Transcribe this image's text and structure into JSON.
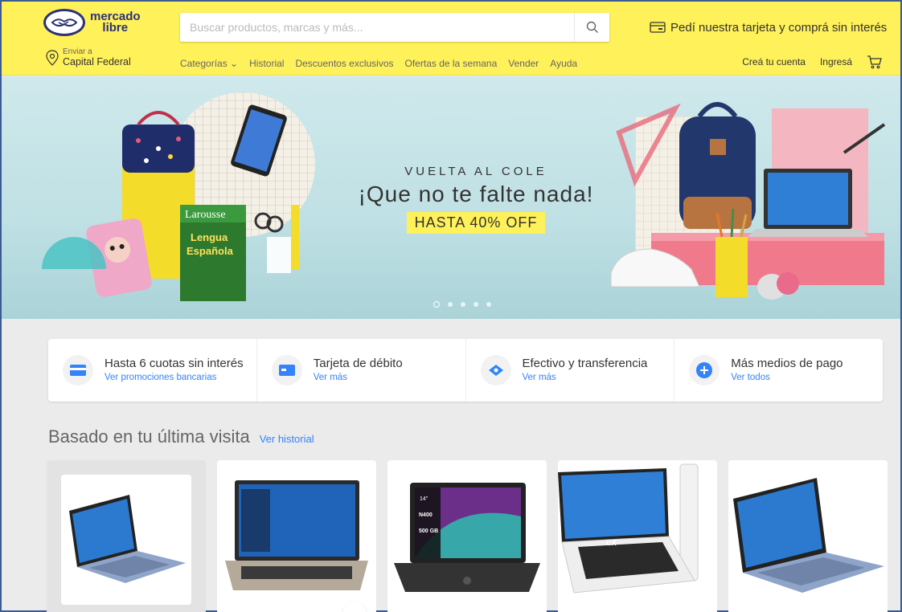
{
  "header": {
    "logo_line1": "mercado",
    "logo_line2": "libre",
    "search_placeholder": "Buscar productos, marcas y más...",
    "promo": "Pedí nuestra tarjeta y comprá sin interés",
    "location_label": "Enviar a",
    "location_value": "Capital Federal",
    "nav": [
      "Categorías",
      "Historial",
      "Descuentos exclusivos",
      "Ofertas de la semana",
      "Vender",
      "Ayuda"
    ],
    "create_account": "Creá tu cuenta",
    "login": "Ingresá",
    "accent_color": "#fff159"
  },
  "hero": {
    "kicker": "VUELTA AL COLE",
    "title": "¡Que no te falte nada!",
    "offer": "HASTA 40% OFF",
    "slides": 5,
    "active_slide": 1,
    "book_brand": "Larousse",
    "book_title_1": "Lengua",
    "book_title_2": "Española"
  },
  "payments": [
    {
      "title": "Hasta 6 cuotas sin interés",
      "link": "Ver promociones bancarias",
      "icon": "credit-card-icon"
    },
    {
      "title": "Tarjeta de débito",
      "link": "Ver más",
      "icon": "debit-card-icon"
    },
    {
      "title": "Efectivo y transferencia",
      "link": "Ver más",
      "icon": "cash-icon"
    },
    {
      "title": "Más medios de pago",
      "link": "Ver todos",
      "icon": "plus-icon"
    }
  ],
  "section": {
    "title": "Basado en tu última visita",
    "link": "Ver historial"
  },
  "products": [
    {
      "name": "laptop-1"
    },
    {
      "name": "laptop-2"
    },
    {
      "name": "laptop-3",
      "screen_text": "14\"",
      "screen_spec_1": "N400",
      "screen_spec_2": "500 GB"
    },
    {
      "name": "laptop-4",
      "brand": "CX"
    },
    {
      "name": "laptop-5"
    }
  ]
}
